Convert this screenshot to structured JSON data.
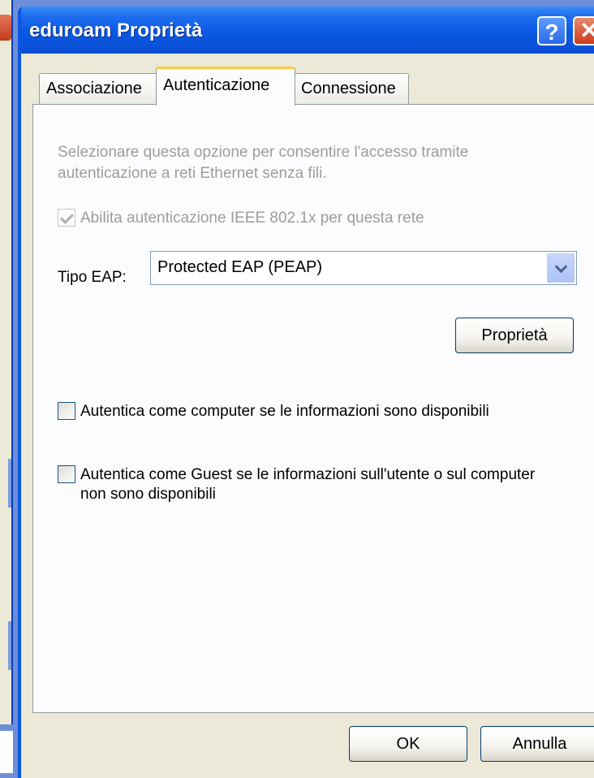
{
  "window": {
    "title": "eduroam Proprietà",
    "help_label": "?",
    "close_label": "✕"
  },
  "tabs": [
    {
      "label": "Associazione",
      "active": false
    },
    {
      "label": "Autenticazione",
      "active": true
    },
    {
      "label": "Connessione",
      "active": false
    }
  ],
  "panel": {
    "description": "Selezionare questa opzione per consentire l'accesso tramite autenticazione a reti Ethernet senza fili.",
    "enable_8021x": {
      "label": "Abilita autenticazione IEEE 802.1x per questa rete",
      "checked": true,
      "disabled": true
    },
    "eap_type_label": "Tipo EAP:",
    "eap_type_value": "Protected EAP (PEAP)",
    "properties_button": "Proprietà",
    "auth_computer": {
      "label": "Autentica come computer se le informazioni sono disponibili",
      "checked": false
    },
    "auth_guest": {
      "label": "Autentica come Guest se le informazioni sull'utente o sul computer non sono disponibili",
      "checked": false
    }
  },
  "footer": {
    "ok_label": "OK",
    "cancel_label": "Annulla"
  },
  "colors": {
    "titlebar": "#0a58e4",
    "dialog_bg": "#ece9d8",
    "panel_bg": "#fcfcfe",
    "disabled_text": "#9d9d99",
    "active_tab_accent": "#ffc83c"
  }
}
